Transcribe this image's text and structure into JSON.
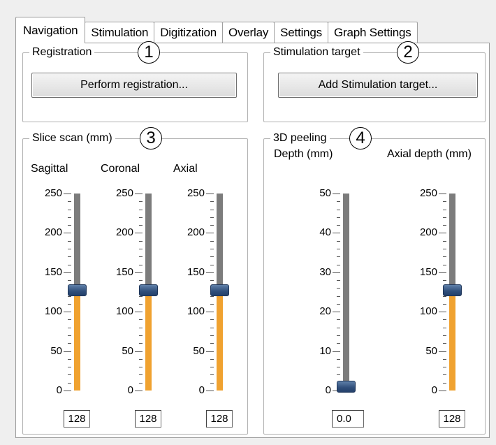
{
  "tabs": [
    {
      "label": "Navigation",
      "active": true
    },
    {
      "label": "Stimulation",
      "active": false
    },
    {
      "label": "Digitization",
      "active": false
    },
    {
      "label": "Overlay",
      "active": false
    },
    {
      "label": "Settings",
      "active": false
    },
    {
      "label": "Graph Settings",
      "active": false
    }
  ],
  "registration": {
    "title": "Registration",
    "badge": "1",
    "button_label": "Perform registration..."
  },
  "stimulation_target": {
    "title": "Stimulation target",
    "badge": "2",
    "button_label": "Add Stimulation target..."
  },
  "slice_scan": {
    "title": "Slice scan (mm)",
    "badge": "3",
    "sliders": [
      {
        "label": "Sagittal",
        "min": 0,
        "max": 250,
        "value": 128,
        "value_text": "128",
        "ticks": [
          "250",
          "200",
          "150",
          "100",
          "50",
          "0"
        ]
      },
      {
        "label": "Coronal",
        "min": 0,
        "max": 250,
        "value": 128,
        "value_text": "128",
        "ticks": [
          "250",
          "200",
          "150",
          "100",
          "50",
          "0"
        ]
      },
      {
        "label": "Axial",
        "min": 0,
        "max": 250,
        "value": 128,
        "value_text": "128",
        "ticks": [
          "250",
          "200",
          "150",
          "100",
          "50",
          "0"
        ]
      }
    ]
  },
  "peeling": {
    "title": "3D peeling",
    "badge": "4",
    "sliders": [
      {
        "label": "Depth (mm)",
        "min": 0,
        "max": 50,
        "value": 0,
        "value_text": "0.0",
        "ticks": [
          "50",
          "40",
          "30",
          "20",
          "10",
          "0"
        ]
      },
      {
        "label": "Axial depth (mm)",
        "min": 0,
        "max": 250,
        "value": 128,
        "value_text": "128",
        "ticks": [
          "250",
          "200",
          "150",
          "100",
          "50",
          "0"
        ]
      }
    ]
  },
  "colors": {
    "track": "#7c7c7c",
    "fill": "#f0a230",
    "thumb": "#2f4e7a"
  }
}
